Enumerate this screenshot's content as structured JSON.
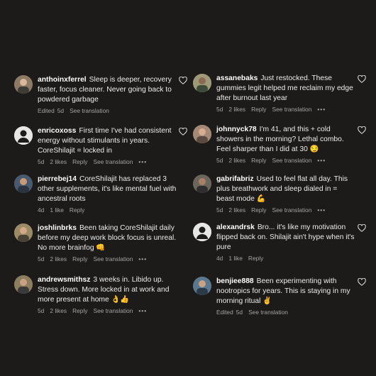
{
  "colors": {
    "background": "#1c1b1a",
    "text": "#ececec",
    "meta": "#a3a3a3"
  },
  "comments_left": [
    {
      "username": "anthoinxferrel",
      "text": "Sleep is deeper, recovery faster, focus cleaner. Never going back to powdered garbage",
      "edited": "Edited",
      "time": "5d",
      "likes": "",
      "reply": "",
      "translate": "See translation",
      "more": "",
      "avatar_color": "#7a6a5c"
    },
    {
      "username": "enricoxoss",
      "text": "First time I've had consistent energy without stimulants in years. CoreShilajit = locked in",
      "edited": "",
      "time": "5d",
      "likes": "2 likes",
      "reply": "Reply",
      "translate": "See translation",
      "more": "•••",
      "avatar_color": "#e6e6e6"
    },
    {
      "username": "pierrebej14",
      "text": "CoreShilajit has replaced 3 other supplements, it's like mental fuel with ancestral roots",
      "edited": "",
      "time": "4d",
      "likes": "1 like",
      "reply": "Reply",
      "translate": "",
      "more": "",
      "avatar_color": "#3b4a5e"
    },
    {
      "username": "joshlinbrks",
      "text": "Been taking CoreShilajit daily before my deep work block focus is unreal. No more brainfog 👊",
      "edited": "",
      "time": "5d",
      "likes": "2 likes",
      "reply": "Reply",
      "translate": "See translation",
      "more": "•••",
      "avatar_color": "#8a7a5a"
    },
    {
      "username": "andrewsmithsz",
      "text": "3 weeks in. Libido up. Stress down. More locked in at work and more present at home 👌👍",
      "edited": "",
      "time": "5d",
      "likes": "2 likes",
      "reply": "Reply",
      "translate": "See translation",
      "more": "•••",
      "avatar_color": "#7b6d55"
    }
  ],
  "comments_right": [
    {
      "username": "assanebaks",
      "text": "Just restocked. These gummies legit helped me reclaim my edge after burnout last year",
      "edited": "",
      "time": "5d",
      "likes": "2 likes",
      "reply": "Reply",
      "translate": "See translation",
      "more": "•••",
      "avatar_color": "#8e8a6e"
    },
    {
      "username": "johnnyck78",
      "text": "I'm 41, and this + cold showers in the morning? Lethal combo. Feel sharper than I did at 30 😏",
      "edited": "",
      "time": "5d",
      "likes": "2 likes",
      "reply": "Reply",
      "translate": "See translation",
      "more": "•••",
      "avatar_color": "#9a7e6a"
    },
    {
      "username": "gabrifabriz",
      "text": "Used to feel flat all day. This plus breathwork and sleep dialed in = beast mode 💪",
      "edited": "",
      "time": "5d",
      "likes": "2 likes",
      "reply": "Reply",
      "translate": "See translation",
      "more": "•••",
      "avatar_color": "#5e5a52"
    },
    {
      "username": "alexandrsk",
      "text": "Bro... it's like my motivation flipped back on. Shilajit ain't hype when it's pure",
      "edited": "",
      "time": "4d",
      "likes": "1 like",
      "reply": "Reply",
      "translate": "",
      "more": "",
      "avatar_color": "#e6e6e6"
    },
    {
      "username": "benjiee888",
      "text": "Been experimenting with nootropics for years. This is staying in my morning ritual ✌️",
      "edited": "Edited",
      "time": "5d",
      "likes": "",
      "reply": "",
      "translate": "See translation",
      "more": "",
      "avatar_color": "#4f6a7e"
    }
  ]
}
